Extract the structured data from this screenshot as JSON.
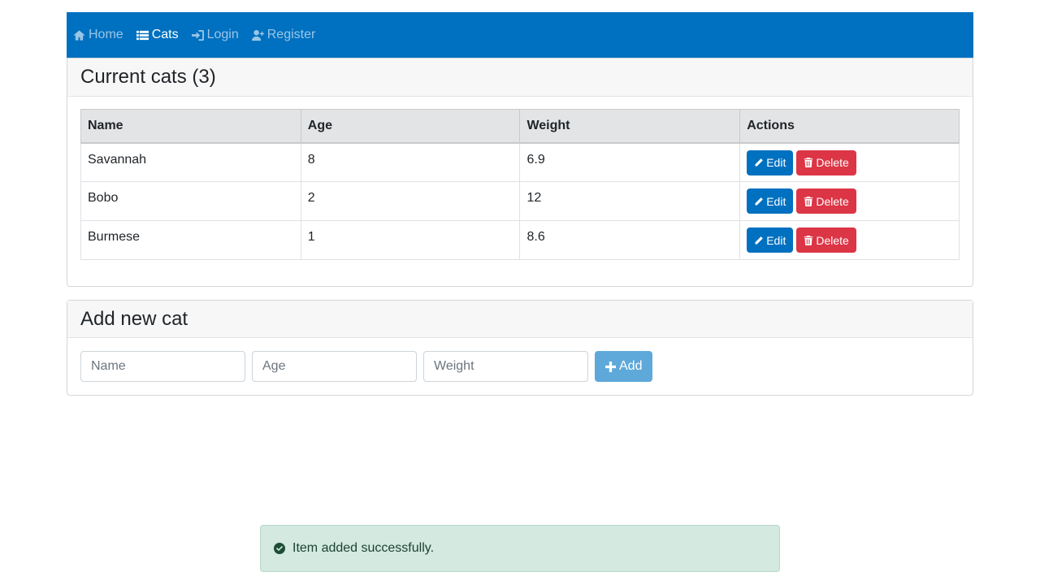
{
  "nav": {
    "items": [
      {
        "label": "Home",
        "icon": "home-icon"
      },
      {
        "label": "Cats",
        "icon": "list-icon",
        "active": true
      },
      {
        "label": "Login",
        "icon": "sign-in-icon"
      },
      {
        "label": "Register",
        "icon": "user-plus-icon"
      }
    ],
    "background": "#0070c0"
  },
  "cats_card": {
    "title": "Current cats (3)",
    "columns": [
      "Name",
      "Age",
      "Weight",
      "Actions"
    ],
    "rows": [
      {
        "name": "Savannah",
        "age": "8",
        "weight": "6.9"
      },
      {
        "name": "Bobo",
        "age": "2",
        "weight": "12"
      },
      {
        "name": "Burmese",
        "age": "1",
        "weight": "8.6"
      }
    ],
    "edit_label": "Edit",
    "delete_label": "Delete"
  },
  "add_card": {
    "title": "Add new cat",
    "name_placeholder": "Name",
    "age_placeholder": "Age",
    "weight_placeholder": "Weight",
    "add_label": "Add"
  },
  "alert": {
    "message": "Item added successfully.",
    "icon": "check-circle-icon"
  },
  "colors": {
    "primary": "#0070c0",
    "danger": "#dc3545",
    "success_bg": "#d4e9e0"
  }
}
